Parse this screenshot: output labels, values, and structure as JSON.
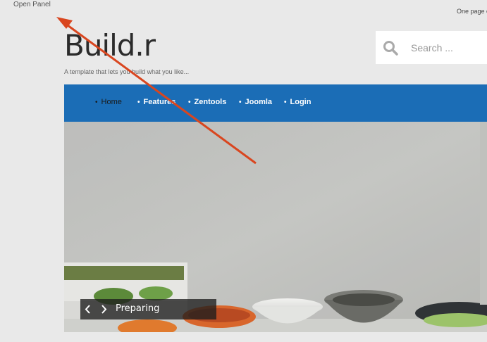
{
  "header": {
    "open_panel_label": "Open Panel",
    "right_tagline": "One page e",
    "logo_text": "Build.r",
    "subtitle": "A template that lets you build what you like..."
  },
  "search": {
    "placeholder": "Search ...",
    "icon": "search-icon"
  },
  "nav": {
    "items": [
      {
        "label": "Home",
        "active": true
      },
      {
        "label": "Features",
        "active": false
      },
      {
        "label": "Zentools",
        "active": false
      },
      {
        "label": "Joomla",
        "active": false
      },
      {
        "label": "Login",
        "active": false
      }
    ]
  },
  "slider": {
    "caption": "Preparing",
    "prev_icon": "chevron-left-icon",
    "next_icon": "chevron-right-icon"
  },
  "colors": {
    "page_bg": "#e9e9e9",
    "nav_bg": "#1b6db6",
    "annotation_arrow": "#d9461f"
  }
}
